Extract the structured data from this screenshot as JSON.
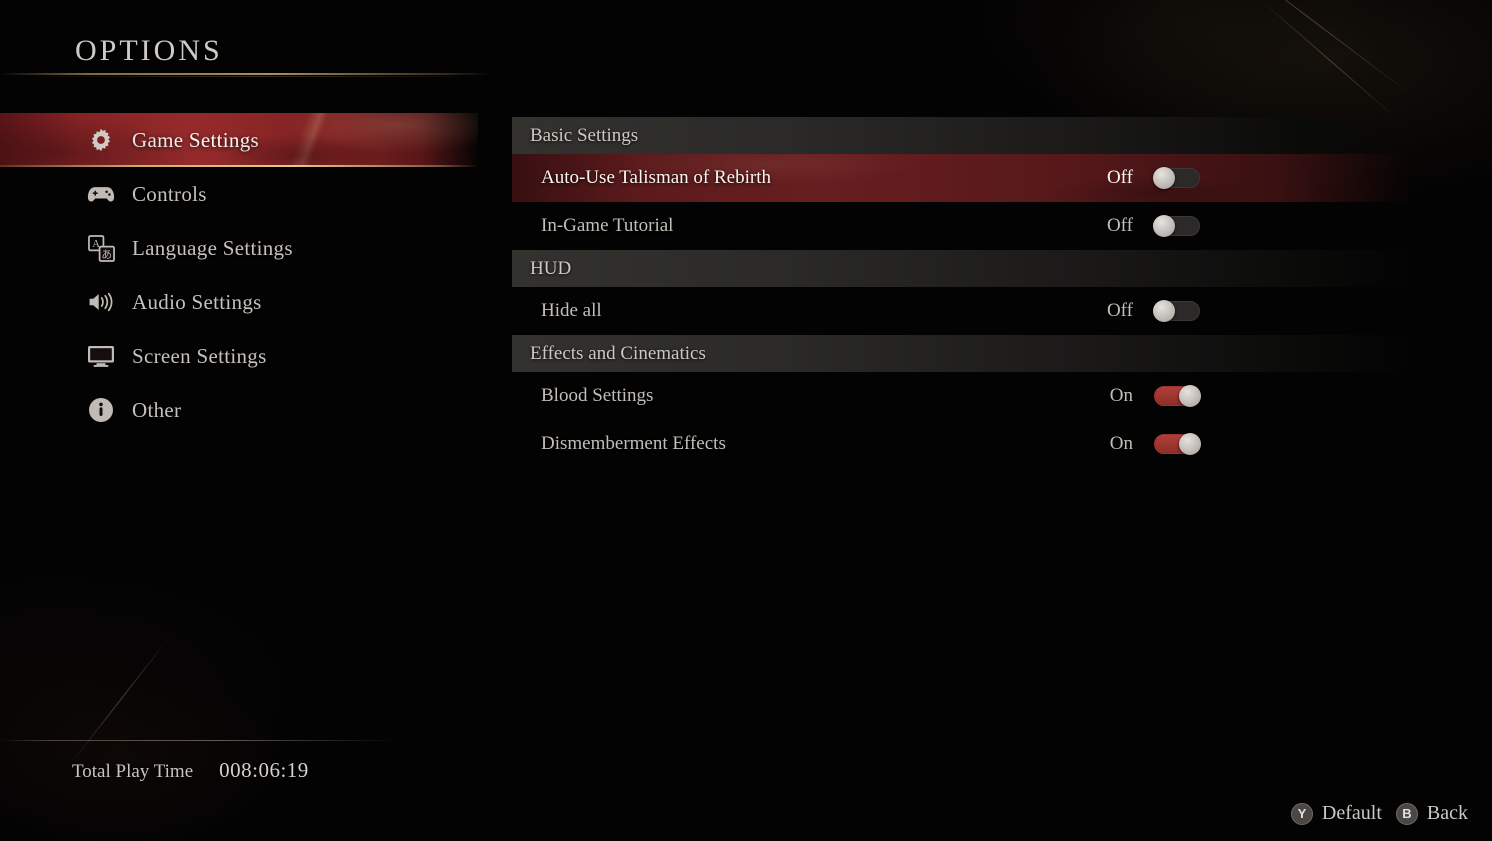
{
  "screen": {
    "title": "OPTIONS",
    "accent_red": "#962a2b",
    "toggle_on_color": "#a33b33",
    "gold_rule": "#d6b676"
  },
  "sidebar": {
    "items": [
      {
        "label": "Game Settings",
        "icon": "gear-icon",
        "selected": true
      },
      {
        "label": "Controls",
        "icon": "gamepad-icon",
        "selected": false
      },
      {
        "label": "Language Settings",
        "icon": "language-icon",
        "selected": false
      },
      {
        "label": "Audio Settings",
        "icon": "speaker-icon",
        "selected": false
      },
      {
        "label": "Screen Settings",
        "icon": "monitor-icon",
        "selected": false
      },
      {
        "label": "Other",
        "icon": "info-icon",
        "selected": false
      }
    ]
  },
  "panel": {
    "sections": [
      {
        "header": "Basic Settings",
        "options": [
          {
            "label": "Auto-Use Talisman of Rebirth",
            "state": "Off",
            "on": false,
            "selected": true
          },
          {
            "label": "In-Game Tutorial",
            "state": "Off",
            "on": false,
            "selected": false
          }
        ]
      },
      {
        "header": "HUD",
        "options": [
          {
            "label": "Hide all",
            "state": "Off",
            "on": false,
            "selected": false
          }
        ]
      },
      {
        "header": "Effects and Cinematics",
        "options": [
          {
            "label": "Blood Settings",
            "state": "On",
            "on": true,
            "selected": false
          },
          {
            "label": "Dismemberment Effects",
            "state": "On",
            "on": true,
            "selected": false
          }
        ]
      }
    ]
  },
  "footer": {
    "playtime_label": "Total Play Time",
    "playtime_value": "008:06:19",
    "prompts": [
      {
        "glyph": "Y",
        "label": "Default"
      },
      {
        "glyph": "B",
        "label": "Back"
      }
    ]
  }
}
